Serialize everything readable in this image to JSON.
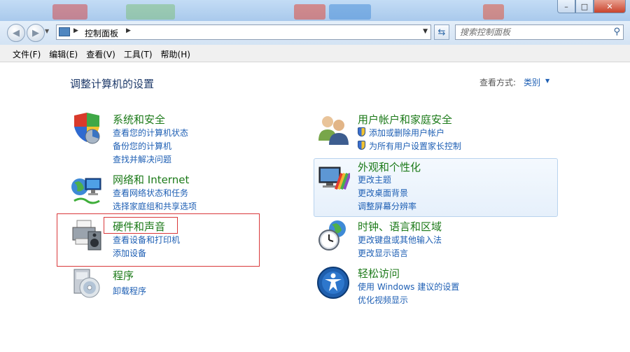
{
  "window": {
    "minimize_label": "–",
    "maximize_label": "□",
    "close_label": "✕"
  },
  "address": {
    "crumb": "控制面板"
  },
  "search": {
    "placeholder": "搜索控制面板"
  },
  "menu": [
    "文件(F)",
    "编辑(E)",
    "查看(V)",
    "工具(T)",
    "帮助(H)"
  ],
  "content": {
    "title": "调整计算机的设置",
    "view_by_label": "查看方式:",
    "view_by_value": "类别"
  },
  "categories": [
    {
      "title": "系统和安全",
      "links": [
        "查看您的计算机状态",
        "备份您的计算机",
        "查找并解决问题"
      ],
      "icon": "system-security-icon"
    },
    {
      "title": "用户帐户和家庭安全",
      "links": [
        "添加或删除用户帐户",
        "为所有用户设置家长控制"
      ],
      "icon": "users-icon"
    },
    {
      "title": "网络和 Internet",
      "links": [
        "查看网络状态和任务",
        "选择家庭组和共享选项"
      ],
      "icon": "network-icon"
    },
    {
      "title": "外观和个性化",
      "links": [
        "更改主题",
        "更改桌面背景",
        "调整屏幕分辨率"
      ],
      "icon": "appearance-icon"
    },
    {
      "title": "硬件和声音",
      "links": [
        "查看设备和打印机",
        "添加设备"
      ],
      "icon": "hardware-sound-icon"
    },
    {
      "title": "时钟、语言和区域",
      "links": [
        "更改键盘或其他输入法",
        "更改显示语言"
      ],
      "icon": "clock-icon"
    },
    {
      "title": "程序",
      "links": [
        "卸载程序"
      ],
      "icon": "programs-icon"
    },
    {
      "title": "轻松访问",
      "links": [
        "使用 Windows 建议的设置",
        "优化视频显示"
      ],
      "icon": "ease-of-access-icon"
    }
  ],
  "colors": {
    "category_title": "#1c7a19",
    "link": "#1e5fb4",
    "highlight_box": "#d9383a"
  }
}
